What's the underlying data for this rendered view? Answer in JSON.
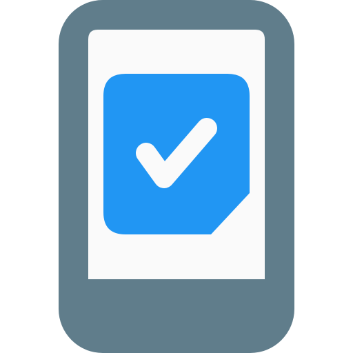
{
  "icon": {
    "semantic": "mobile-phone-with-checked-note-icon",
    "colors": {
      "device_body": "#607D8B",
      "screen": "#FAFAFA",
      "note": "#2196F3",
      "checkmark": "#FAFAFA"
    }
  }
}
